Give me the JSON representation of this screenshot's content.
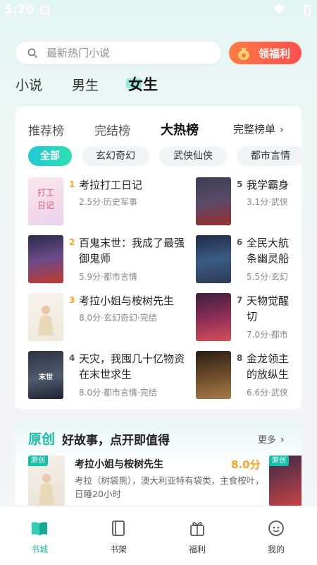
{
  "status": {
    "time": "5:20"
  },
  "search": {
    "placeholder": "最新热门小说"
  },
  "welfare_button": {
    "label": "领福利"
  },
  "top_tabs": [
    {
      "label": "小说"
    },
    {
      "label": "男生"
    },
    {
      "label": "女生",
      "active": true
    }
  ],
  "ranking": {
    "tabs": [
      {
        "label": "推荐榜"
      },
      {
        "label": "完结榜"
      },
      {
        "label": "大热榜",
        "active": true
      }
    ],
    "more_label": "完整榜单",
    "categories": [
      {
        "label": "全部",
        "active": true
      },
      {
        "label": "玄幻奇幻"
      },
      {
        "label": "武侠仙侠"
      },
      {
        "label": "都市言情"
      }
    ],
    "books": [
      {
        "rank": "1",
        "title": "考拉打工日记",
        "meta": "2.5分·历史军事"
      },
      {
        "rank": "2",
        "title": "百鬼末世：我成了最强",
        "title2": "御鬼师",
        "meta": "5.9分·都市言情"
      },
      {
        "rank": "3",
        "title": "考拉小姐与桉树先生",
        "meta": "8.0分·玄幻奇幻·完结"
      },
      {
        "rank": "4",
        "title": "天灾，我囤几十亿物资",
        "title2": "在末世求生",
        "meta": "8.0分·都市言情·完结"
      },
      {
        "rank": "5",
        "title": "我学霸身",
        "meta": "3.1分·武侠"
      },
      {
        "rank": "6",
        "title": "全民大航",
        "title2": "条幽灵船",
        "meta": "5.5分·玄幻"
      },
      {
        "rank": "7",
        "title": "天物觉醒",
        "title2": "切",
        "meta": "7.0分·都市"
      },
      {
        "rank": "8",
        "title": "金龙领主",
        "title2": "的放纵生",
        "meta": "6.6分·武侠"
      }
    ]
  },
  "original": {
    "tag": "原创",
    "title": "好故事，点开即值得",
    "more_label": "更多",
    "book": {
      "badge": "原创",
      "title": "考拉小姐与桉树先生",
      "score": "8.0分",
      "desc": "考拉（树袋熊），澳大利亚特有袋类，主食桉叶，日睡20小时"
    },
    "side_badge": "原创"
  },
  "bottom_nav": [
    {
      "label": "书城",
      "icon": "bookstore-icon",
      "active": true
    },
    {
      "label": "书架",
      "icon": "bookshelf-icon"
    },
    {
      "label": "福利",
      "icon": "gift-icon"
    },
    {
      "label": "我的",
      "icon": "profile-icon"
    }
  ],
  "colors": {
    "accent": "#16c0a8",
    "orange": "#ff5a4a",
    "score": "#f5a623"
  }
}
